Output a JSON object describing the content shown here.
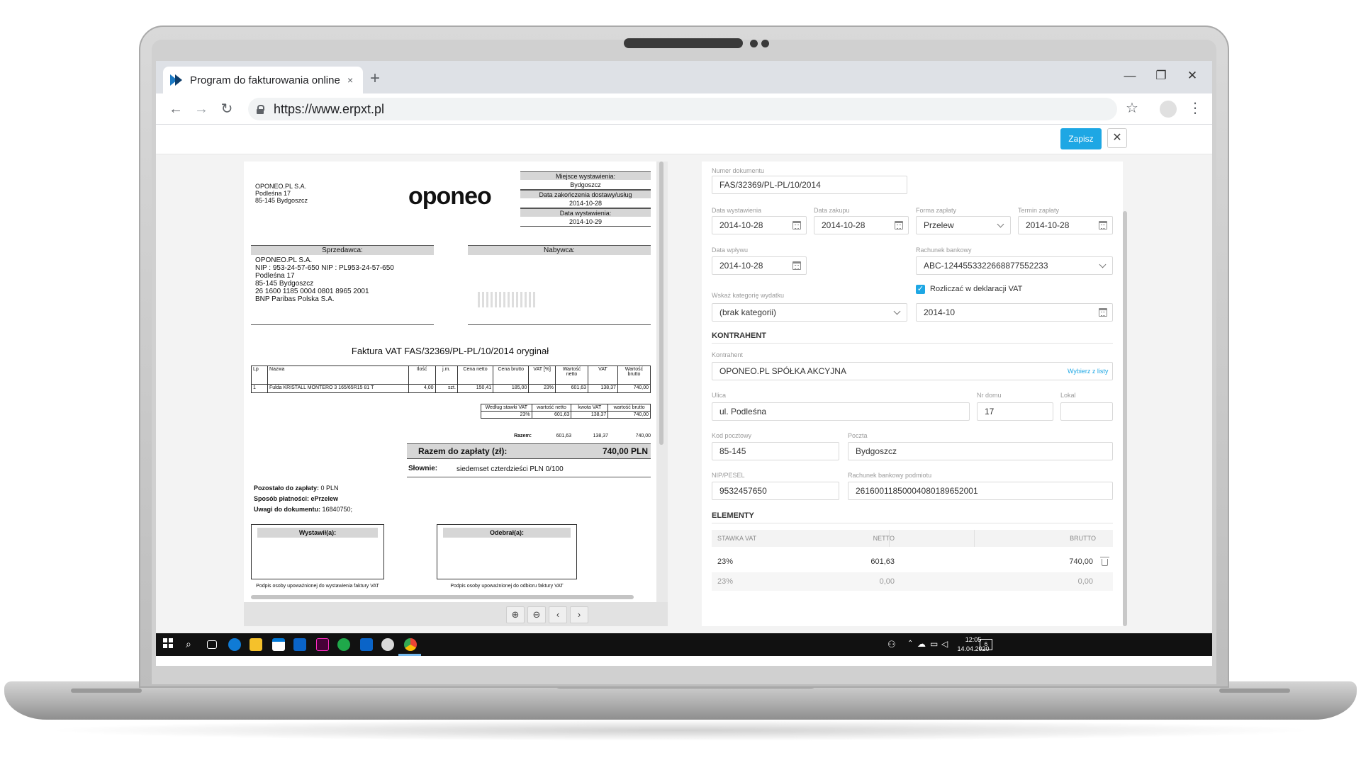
{
  "browser": {
    "tab_title": "Program do fakturowania online",
    "tab_close": "×",
    "new_tab": "+",
    "url": "https://www.erpxt.pl",
    "win_minimize": "—",
    "win_restore": "❐",
    "win_close": "✕",
    "back": "←",
    "forward": "→",
    "reload": "↻",
    "star": "☆",
    "menu": "⋮"
  },
  "toolbar": {
    "save_label": "Zapisz",
    "close_label": "✕"
  },
  "invoice_preview": {
    "seller_block": {
      "line1": "OPONEO.PL S.A.",
      "line2": "Podleśna 17",
      "line3": "85-145 Bydgoszcz"
    },
    "logo": "oponeo",
    "meta": [
      {
        "label": "Miejsce wystawienia:",
        "value": "Bydgoszcz"
      },
      {
        "label": "Data zakończenia dostawy/usług",
        "value": "2014-10-28"
      },
      {
        "label": "Data wystawienia:",
        "value": "2014-10-29"
      }
    ],
    "seller_header": "Sprzedawca:",
    "buyer_header": "Nabywca:",
    "seller_details": {
      "name": "OPONEO.PL S.A.",
      "nip": "NIP : 953-24-57-650  NIP : PL953-24-57-650",
      "street": "Podleśna 17",
      "city": "85-145 Bydgoszcz",
      "account": "26 1600 1185 0004 0801 8965 2001",
      "bank": "BNP Paribas Polska S.A."
    },
    "title": "Faktura VAT FAS/32369/PL-PL/10/2014 oryginał",
    "items_headers": [
      "Lp",
      "Nazwa",
      "Ilość",
      "j.m.",
      "Cena netto",
      "Cena brutto",
      "VAT [%]",
      "Wartość netto",
      "VAT",
      "Wartość brutto"
    ],
    "items": [
      [
        "1",
        "Fulda KRISTALL MONTERO 3 165/65R15 81 T",
        "4,00",
        "szt.",
        "150,41",
        "185,00",
        "23%",
        "601,63",
        "138,37",
        "740,00"
      ]
    ],
    "vat_headers": [
      "Według stawki VAT",
      "wartość netto",
      "kwota VAT",
      "wartość brutto"
    ],
    "vat_rows": [
      [
        "23%",
        "601,63",
        "138,37",
        "740,00"
      ]
    ],
    "vat_total_label": "Razem:",
    "vat_total": [
      "601,63",
      "138,37",
      "740,00"
    ],
    "pay_label": "Razem do zapłaty (zł):",
    "pay_value": "740,00 PLN",
    "words_label": "Słownie:",
    "words_value": "siedemset czterdzieści PLN 0/100",
    "remaining_label": "Pozostało do zapłaty:",
    "remaining_value": "0 PLN",
    "method_label": "Sposób płatności:",
    "method_value": "ePrzelew",
    "notes_label": "Uwagi do dokumentu:",
    "notes_value": "16840750;",
    "issued_by": "Wystawił(a):",
    "received_by": "Odebrał(a):",
    "issued_note": "Podpis osoby upoważnionej do wystawienia faktury VAT",
    "received_note": "Podpis osoby upoważnionej do odbioru faktury VAT"
  },
  "form": {
    "doc_number_label": "Numer dokumentu",
    "doc_number": "FAS/32369/PL-PL/10/2014",
    "issue_date_label": "Data wystawienia",
    "issue_date": "2014-10-28",
    "purchase_date_label": "Data zakupu",
    "purchase_date": "2014-10-28",
    "payment_form_label": "Forma zapłaty",
    "payment_form": "Przelew",
    "payment_due_label": "Termin zapłaty",
    "payment_due": "2014-10-28",
    "receipt_date_label": "Data wpływu",
    "receipt_date": "2014-10-28",
    "bank_account_label": "Rachunek bankowy",
    "bank_account": "ABC-1244553322668877552233",
    "vat_checkbox_label": "Rozliczać w deklaracji VAT",
    "vat_period": "2014-10",
    "category_label": "Wskaż kategorię wydatku",
    "category": "(brak kategorii)",
    "contractor_section": "KONTRAHENT",
    "contractor_label": "Kontrahent",
    "contractor": "OPONEO.PL SPÓŁKA AKCYJNA",
    "pick_link": "Wybierz z listy",
    "street_label": "Ulica",
    "street": "ul. Podleśna",
    "house_label": "Nr domu",
    "house": "17",
    "flat_label": "Lokal",
    "flat": "",
    "postcode_label": "Kod pocztowy",
    "postcode": "85-145",
    "post_label": "Poczta",
    "post": "Bydgoszcz",
    "nip_label": "NIP/PESEL",
    "nip": "9532457650",
    "contractor_account_label": "Rachunek bankowy podmiotu",
    "contractor_account": "26160011850004080189652001",
    "elements_section": "ELEMENTY",
    "elements_headers": [
      "STAWKA VAT",
      "NETTO",
      "BRUTTO"
    ],
    "elements_rows": [
      [
        "23%",
        "601,63",
        "740,00"
      ],
      [
        "23%",
        "0,00",
        "0,00"
      ]
    ]
  },
  "taskbar": {
    "time": "12:05",
    "date": "14.04.2020",
    "notifications": "6"
  },
  "colors": {
    "accent": "#1ea7e4"
  }
}
